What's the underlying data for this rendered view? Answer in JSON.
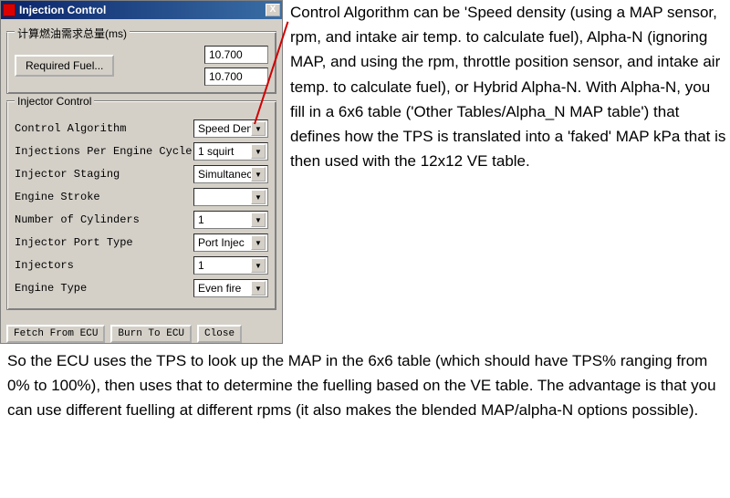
{
  "dialog": {
    "title": "Injection Control",
    "group_fuel": {
      "legend": "计算燃油需求总量(ms)",
      "required_fuel_btn": "Required Fuel...",
      "val1": "10.700",
      "val2": "10.700"
    },
    "group_injector": {
      "legend": "Injector Control",
      "rows": [
        {
          "label": "Control Algorithm",
          "value": "Speed Dens"
        },
        {
          "label": "Injections Per Engine Cycle",
          "value": "1 squirt"
        },
        {
          "label": "Injector Staging",
          "value": "Simultanec"
        },
        {
          "label": "Engine Stroke",
          "value": ""
        },
        {
          "label": "Number of Cylinders",
          "value": "1"
        },
        {
          "label": "Injector Port Type",
          "value": "Port Injec"
        },
        {
          "label": "Injectors",
          "value": "1"
        },
        {
          "label": "Engine Type",
          "value": "Even fire"
        }
      ]
    },
    "buttons": {
      "fetch": "Fetch From ECU",
      "burn": "Burn To ECU",
      "close": "Close"
    },
    "close_x": "X"
  },
  "desc_right": "Control Algorithm can be 'Speed density (using a MAP sensor, rpm, and intake air temp. to calculate fuel), Alpha-N (ignoring MAP, and using the rpm, throttle position sensor, and intake air temp. to calculate fuel), or Hybrid Alpha-N.\nWith Alpha-N, you fill in a 6x6 table ('Other Tables/Alpha_N MAP table') that defines how the TPS is translated into a 'faked' MAP kPa that is then used with the 12x12 VE table.",
  "desc_bottom": "So the ECU uses the TPS to look up the MAP in the 6x6 table (which should have TPS% ranging from 0% to 100%), then uses that to determine the fuelling based on the VE table. The advantage is that you can use different fuelling at different rpms (it also makes the blended MAP/alpha-N options possible).",
  "watermark": ""
}
